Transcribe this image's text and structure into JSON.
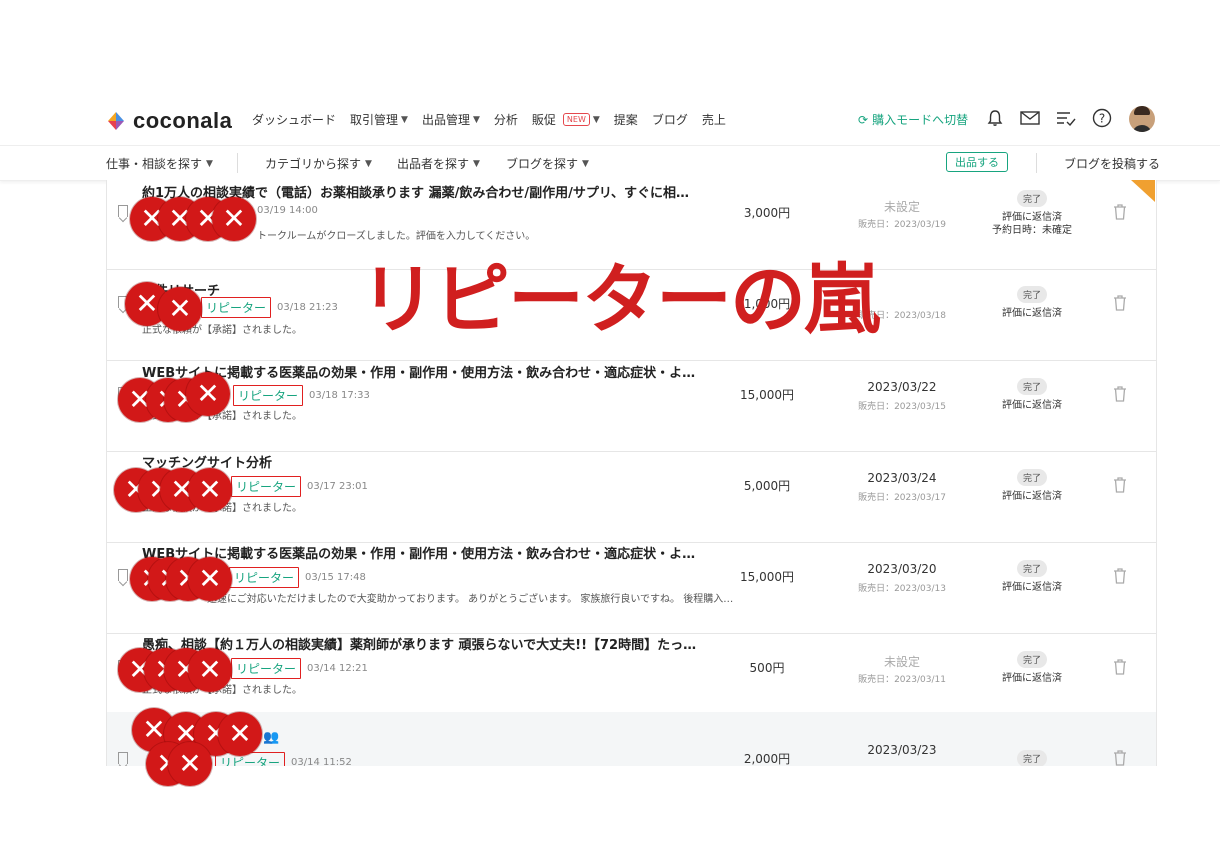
{
  "header": {
    "logo_text": "coconala",
    "nav": [
      {
        "label": "ダッシュボード",
        "chevron": false,
        "badge": ""
      },
      {
        "label": "取引管理",
        "chevron": true,
        "badge": ""
      },
      {
        "label": "出品管理",
        "chevron": true,
        "badge": ""
      },
      {
        "label": "分析",
        "chevron": false,
        "badge": ""
      },
      {
        "label": "販促",
        "chevron": true,
        "badge": "NEW"
      },
      {
        "label": "提案",
        "chevron": false,
        "badge": ""
      },
      {
        "label": "ブログ",
        "chevron": false,
        "badge": ""
      },
      {
        "label": "売上",
        "chevron": false,
        "badge": ""
      }
    ],
    "buy_mode": "購入モードへ切替",
    "icons": [
      "bell-icon",
      "mail-icon",
      "list-check-icon",
      "help-icon"
    ]
  },
  "subnav": {
    "search_jobs": "仕事・相談を探す",
    "search_category": "カテゴリから探す",
    "search_sellers": "出品者を探す",
    "search_blogs": "ブログを探す",
    "sell_button": "出品する",
    "post_blog": "ブログを投稿する"
  },
  "overlay": {
    "title": "リピーターの嵐",
    "color": "#d01f1f"
  },
  "rows": [
    {
      "title": "約1万人の相談実績で（電話）お薬相談承ります 漏薬/飲み合わせ/副作用/サプリ、すぐに相談…",
      "repeater": "",
      "time": "03/19 14:00",
      "message": "トークルームがクローズしました。評価を入力してください。",
      "price": "3,000円",
      "date": "未設定",
      "sold": "販売日：2023/03/19",
      "status": "完了",
      "status_lines": [
        "評価に返信済",
        "予約日時：未確定"
      ]
    },
    {
      "title": "物件リサーチ",
      "repeater": "リピーター",
      "time": "03/18 21:23",
      "message": "正式な依頼が【承諾】されました。",
      "price": "1,000円",
      "date": "",
      "sold": "販売日：2023/03/18",
      "status": "完了",
      "status_lines": [
        "評価に返信済"
      ]
    },
    {
      "title": "WEBサイトに掲載する医薬品の効果・作用・副作用・使用方法・飲み合わせ・適応症状・よく…",
      "repeater": "リピーター",
      "time": "03/18 17:33",
      "message": "正式な依頼が【承諾】されました。",
      "price": "15,000円",
      "date": "2023/03/22",
      "sold": "販売日：2023/03/15",
      "status": "完了",
      "status_lines": [
        "評価に返信済"
      ]
    },
    {
      "title": "マッチングサイト分析",
      "repeater": "リピーター",
      "time": "03/17 23:01",
      "message": "正式な依頼が【承諾】されました。",
      "price": "5,000円",
      "date": "2023/03/24",
      "sold": "販売日：2023/03/17",
      "status": "完了",
      "status_lines": [
        "評価に返信済"
      ]
    },
    {
      "title": "WEBサイトに掲載する医薬品の効果・作用・副作用・使用方法・飲み合わせ・適応症状・よく…",
      "repeater": "リピーター",
      "time": "03/15 17:48",
      "message": "迅速にご対応いただけましたので大変助かっております。 ありがとうございます。 家族旅行良いですね。 後程購入…",
      "price": "15,000円",
      "date": "2023/03/20",
      "sold": "販売日：2023/03/13",
      "status": "完了",
      "status_lines": [
        "評価に返信済"
      ]
    },
    {
      "title": "愚痴、相談【約１万人の相談実績】薬剤師が承ります 頑張らないで大丈夫!!【72時間】たっぷ…",
      "repeater": "リピーター",
      "time": "03/14 12:21",
      "message": "正式な依頼が【承諾】されました。",
      "price": "500円",
      "date": "未設定",
      "sold": "販売日：2023/03/11",
      "status": "完了",
      "status_lines": [
        "評価に返信済"
      ]
    },
    {
      "title": "",
      "repeater": "リピーター",
      "time": "03/14 11:52",
      "message": "",
      "price": "2,000円",
      "date": "2023/03/23",
      "sold": "",
      "status": "完了",
      "status_lines": []
    }
  ]
}
